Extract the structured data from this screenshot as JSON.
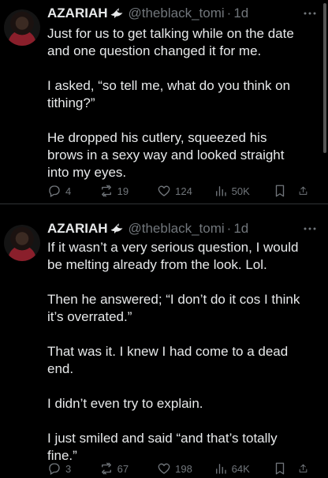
{
  "tweets": [
    {
      "author_name": "AZARIAH",
      "author_emoji": "dove-icon",
      "handle": "@theblack_tomi",
      "separator": "·",
      "time": "1d",
      "paragraphs": [
        "Just for us to get talking while on the date\nand one question changed it for me.",
        "I asked, “so tell me, what do you think on\ntithing?”",
        "He dropped his cutlery, squeezed his\nbrows in a sexy way and looked straight\ninto my eyes."
      ],
      "replies": "4",
      "reposts": "19",
      "likes": "124",
      "views": "50K"
    },
    {
      "author_name": "AZARIAH",
      "author_emoji": "dove-icon",
      "handle": "@theblack_tomi",
      "separator": "·",
      "time": "1d",
      "paragraphs": [
        "If it wasn’t a very serious question, I would\nbe melting already from the look. Lol.",
        "Then he answered; “I don’t do it cos I think\nit’s overrated.”",
        "That was it. I knew I had come to a dead\nend.",
        "I didn’t even try to explain.",
        "I just smiled and said “and that’s totally\nfine.”"
      ],
      "replies": "3",
      "reposts": "67",
      "likes": "198",
      "views": "64K"
    }
  ],
  "colors": {
    "background": "#000000",
    "text": "#e7e9ea",
    "secondary": "#71767b",
    "divider": "#2f3336"
  }
}
